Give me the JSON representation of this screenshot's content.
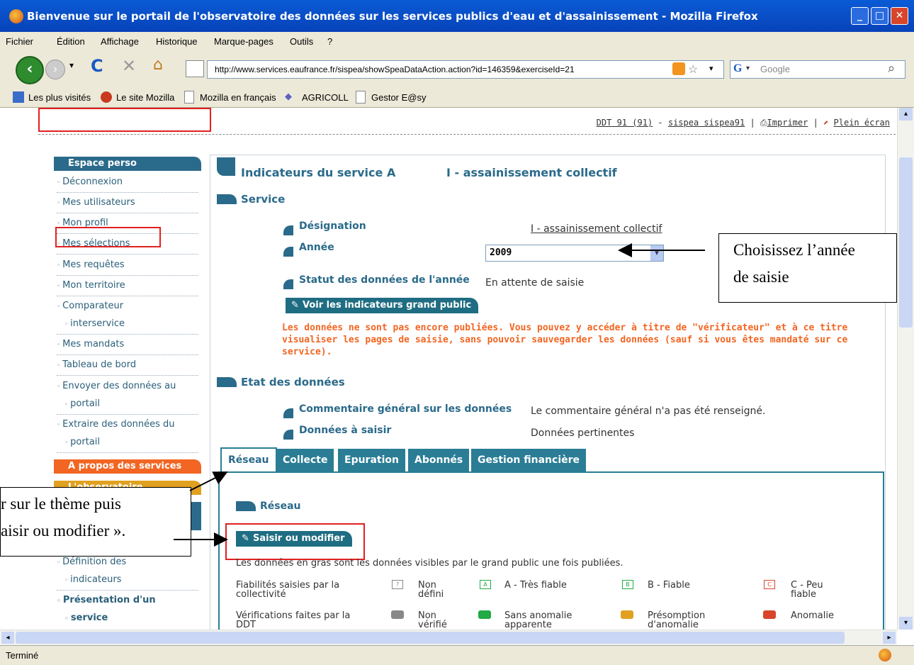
{
  "window": {
    "title": "Bienvenue sur le portail de l'observatoire des données sur les services publics d'eau et d'assainissement - Mozilla Firefox"
  },
  "menu": [
    "Fichier",
    "Édition",
    "Affichage",
    "Historique",
    "Marque-pages",
    "Outils",
    "?"
  ],
  "nav": {
    "url": "http://www.services.eaufrance.fr/sispea/showSpeaDataAction.action?id=146359&exerciseId=21",
    "search_placeholder": "Google"
  },
  "bookmarks": [
    "Les plus visités",
    "Le site Mozilla",
    "Mozilla en français",
    "AGRICOLL",
    "Gestor E@sy"
  ],
  "toplinks": {
    "ddt": "DDT 91 (91)",
    "sep1": "-",
    "user": "sispea sispea91",
    "sep2": "|",
    "print": "Imprimer",
    "sep3": "|",
    "full": "Plein écran"
  },
  "sidebar": {
    "head1": "Espace perso",
    "items": [
      "Déconnexion",
      "Mes utilisateurs",
      "Mon profil",
      "Mes sélections",
      "Mes requêtes",
      "Mon territoire",
      "Comparateur",
      "interservice",
      "Mes mandats",
      "Tableau de bord",
      "Envoyer des données au",
      "portail",
      "Extraire des données du",
      "portail"
    ],
    "head2": "A propos des services",
    "head3": "L'observatoire",
    "items2": [
      "Définition des",
      "indicateurs"
    ],
    "bold1": "Présentation d'un",
    "bold2": "service"
  },
  "main": {
    "title_a": "Indicateurs du service A",
    "title_b": "I - assainissement collectif",
    "service": "Service",
    "designation_label": "Désignation",
    "designation_value": "I - assainissement collectif",
    "annee_label": "Année",
    "annee_value": "2009",
    "statut_label": "Statut des données de l'année",
    "statut_value": "En attente de saisie",
    "voir_btn": "Voir les indicateurs grand public",
    "warning": "Les données ne sont pas encore publiées. Vous pouvez y accéder à titre de \"vérificateur\" et à ce titre visualiser les pages de saisie, sans pouvoir sauvegarder les données (sauf si vous êtes mandaté sur ce service).",
    "etat": "Etat des données",
    "comment_label": "Commentaire général sur les données",
    "comment_value": "Le commentaire général n'a pas été renseigné.",
    "donnees_label": "Données à saisir",
    "donnees_value": "Données pertinentes",
    "tabs": [
      "Réseau",
      "Collecte",
      "Epuration",
      "Abonnés",
      "Gestion financière"
    ],
    "reseau": "Réseau",
    "saisir_btn": "Saisir ou modifier",
    "note": "Les données en gras sont les données visibles par le grand public une fois publiées.",
    "fiab_label1": "Fiabilités saisies par la",
    "fiab_label2": "collectivité",
    "fiab": [
      {
        "icon": "?",
        "l1": "Non",
        "l2": "défini",
        "color": "#888888"
      },
      {
        "icon": "A",
        "l1": "A - Très fiable",
        "l2": "",
        "color": "#22aa44"
      },
      {
        "icon": "B",
        "l1": "B - Fiable",
        "l2": "",
        "color": "#22aa44"
      },
      {
        "icon": "C",
        "l1": "C - Peu",
        "l2": "fiable",
        "color": "#d9452a"
      }
    ],
    "verif_label1": "Vérifications faites par la",
    "verif_label2": "DDT",
    "verif": [
      {
        "l1": "Non",
        "l2": "vérifié",
        "color": "#888888"
      },
      {
        "l1": "Sans anomalie",
        "l2": "apparente",
        "color": "#22aa44"
      },
      {
        "l1": "Présomption",
        "l2": "d'anomalie",
        "color": "#e0a020"
      },
      {
        "l1": "Anomalie",
        "l2": "",
        "color": "#d9452a"
      }
    ]
  },
  "callouts": {
    "right_l1": "Choisissez l’année",
    "right_l2": "de saisie",
    "left_l1": "r sur le thème puis",
    "left_l2": "aisir ou modifier »."
  },
  "status": "Terminé"
}
